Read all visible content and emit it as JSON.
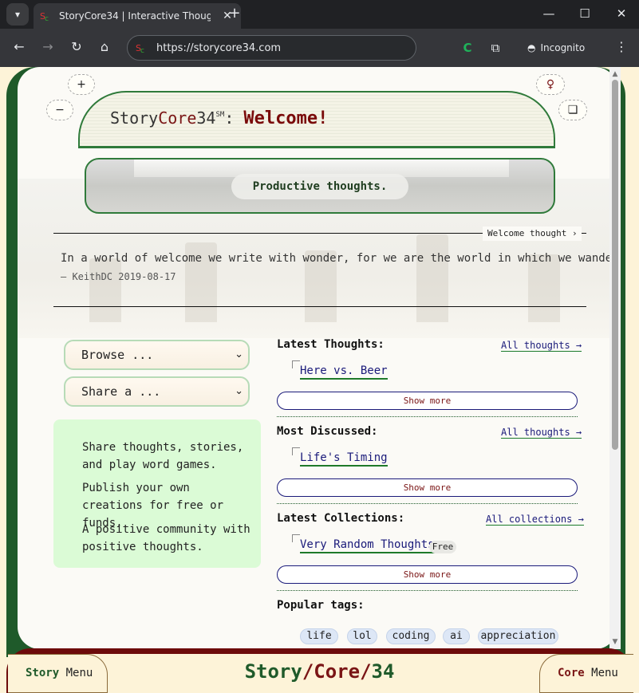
{
  "browser": {
    "tab_title": "StoryCore34 | Interactive Thoug",
    "url": "https://storycore34.com",
    "incognito_label": "Incognito",
    "new_tab_glyph": "+",
    "close_glyph": "✕",
    "icons": [
      "tab-search-icon",
      "favicon-icon",
      "close-icon",
      "new-tab-icon",
      "minimize-icon",
      "maximize-icon",
      "window-close-icon",
      "back-icon",
      "forward-icon",
      "reload-icon",
      "home-icon",
      "site-info-icon",
      "extension-c-icon",
      "extensions-icon",
      "incognito-icon",
      "menu-icon"
    ]
  },
  "header": {
    "zoom_in": "+",
    "zoom_out": "−",
    "lightbulb_glyph": "♀",
    "window_glyph": "❏",
    "site_name_story": "Story",
    "site_name_core": "Core",
    "site_name_num": "34",
    "service_mark": "SM",
    "colon": ":",
    "welcome": "Welcome!",
    "banner_text": "Productive thoughts."
  },
  "quote": {
    "link_label": "Welcome thought ›",
    "text": "In a world of welcome we write with wonder, for we are the world in which we wander.",
    "author": "— KeithDC 2019-08-17"
  },
  "left": {
    "browse_select": "Browse ...",
    "share_select": "Share a ...",
    "info": [
      "Share thoughts, stories, and play word games.",
      "Publish your own creations for free or funds.",
      "A positive community with positive thoughts."
    ]
  },
  "sections": {
    "latest_thoughts": {
      "title": "Latest Thoughts:",
      "link": "All thoughts →",
      "item": "Here vs. Beer",
      "show_more": "Show more"
    },
    "most_discussed": {
      "title": "Most Discussed:",
      "link": "All thoughts →",
      "item": "Life's Timing",
      "show_more": "Show more"
    },
    "latest_collections": {
      "title": "Latest Collections:",
      "link": "All collections →",
      "item": "Very Random Thoughts",
      "badge": "Free",
      "show_more": "Show more"
    },
    "popular_tags": {
      "title": "Popular tags:",
      "tags": [
        "life",
        "lol",
        "coding",
        "ai",
        "appreciation"
      ]
    }
  },
  "footer": {
    "story_menu_bold": "Story",
    "story_menu_rest": " Menu",
    "core_menu_bold": "Core",
    "core_menu_rest": " Menu",
    "title_story": "Story",
    "title_slash1": "/",
    "title_core": "Core",
    "title_slash2": "/",
    "title_num": "34"
  },
  "colors": {
    "frame_green": "#1f5a2a",
    "frame_red": "#6d0a0a",
    "page_cream": "#fdf3d8",
    "link_blue": "#1a1a7a",
    "card_green": "#dbfbd6"
  }
}
